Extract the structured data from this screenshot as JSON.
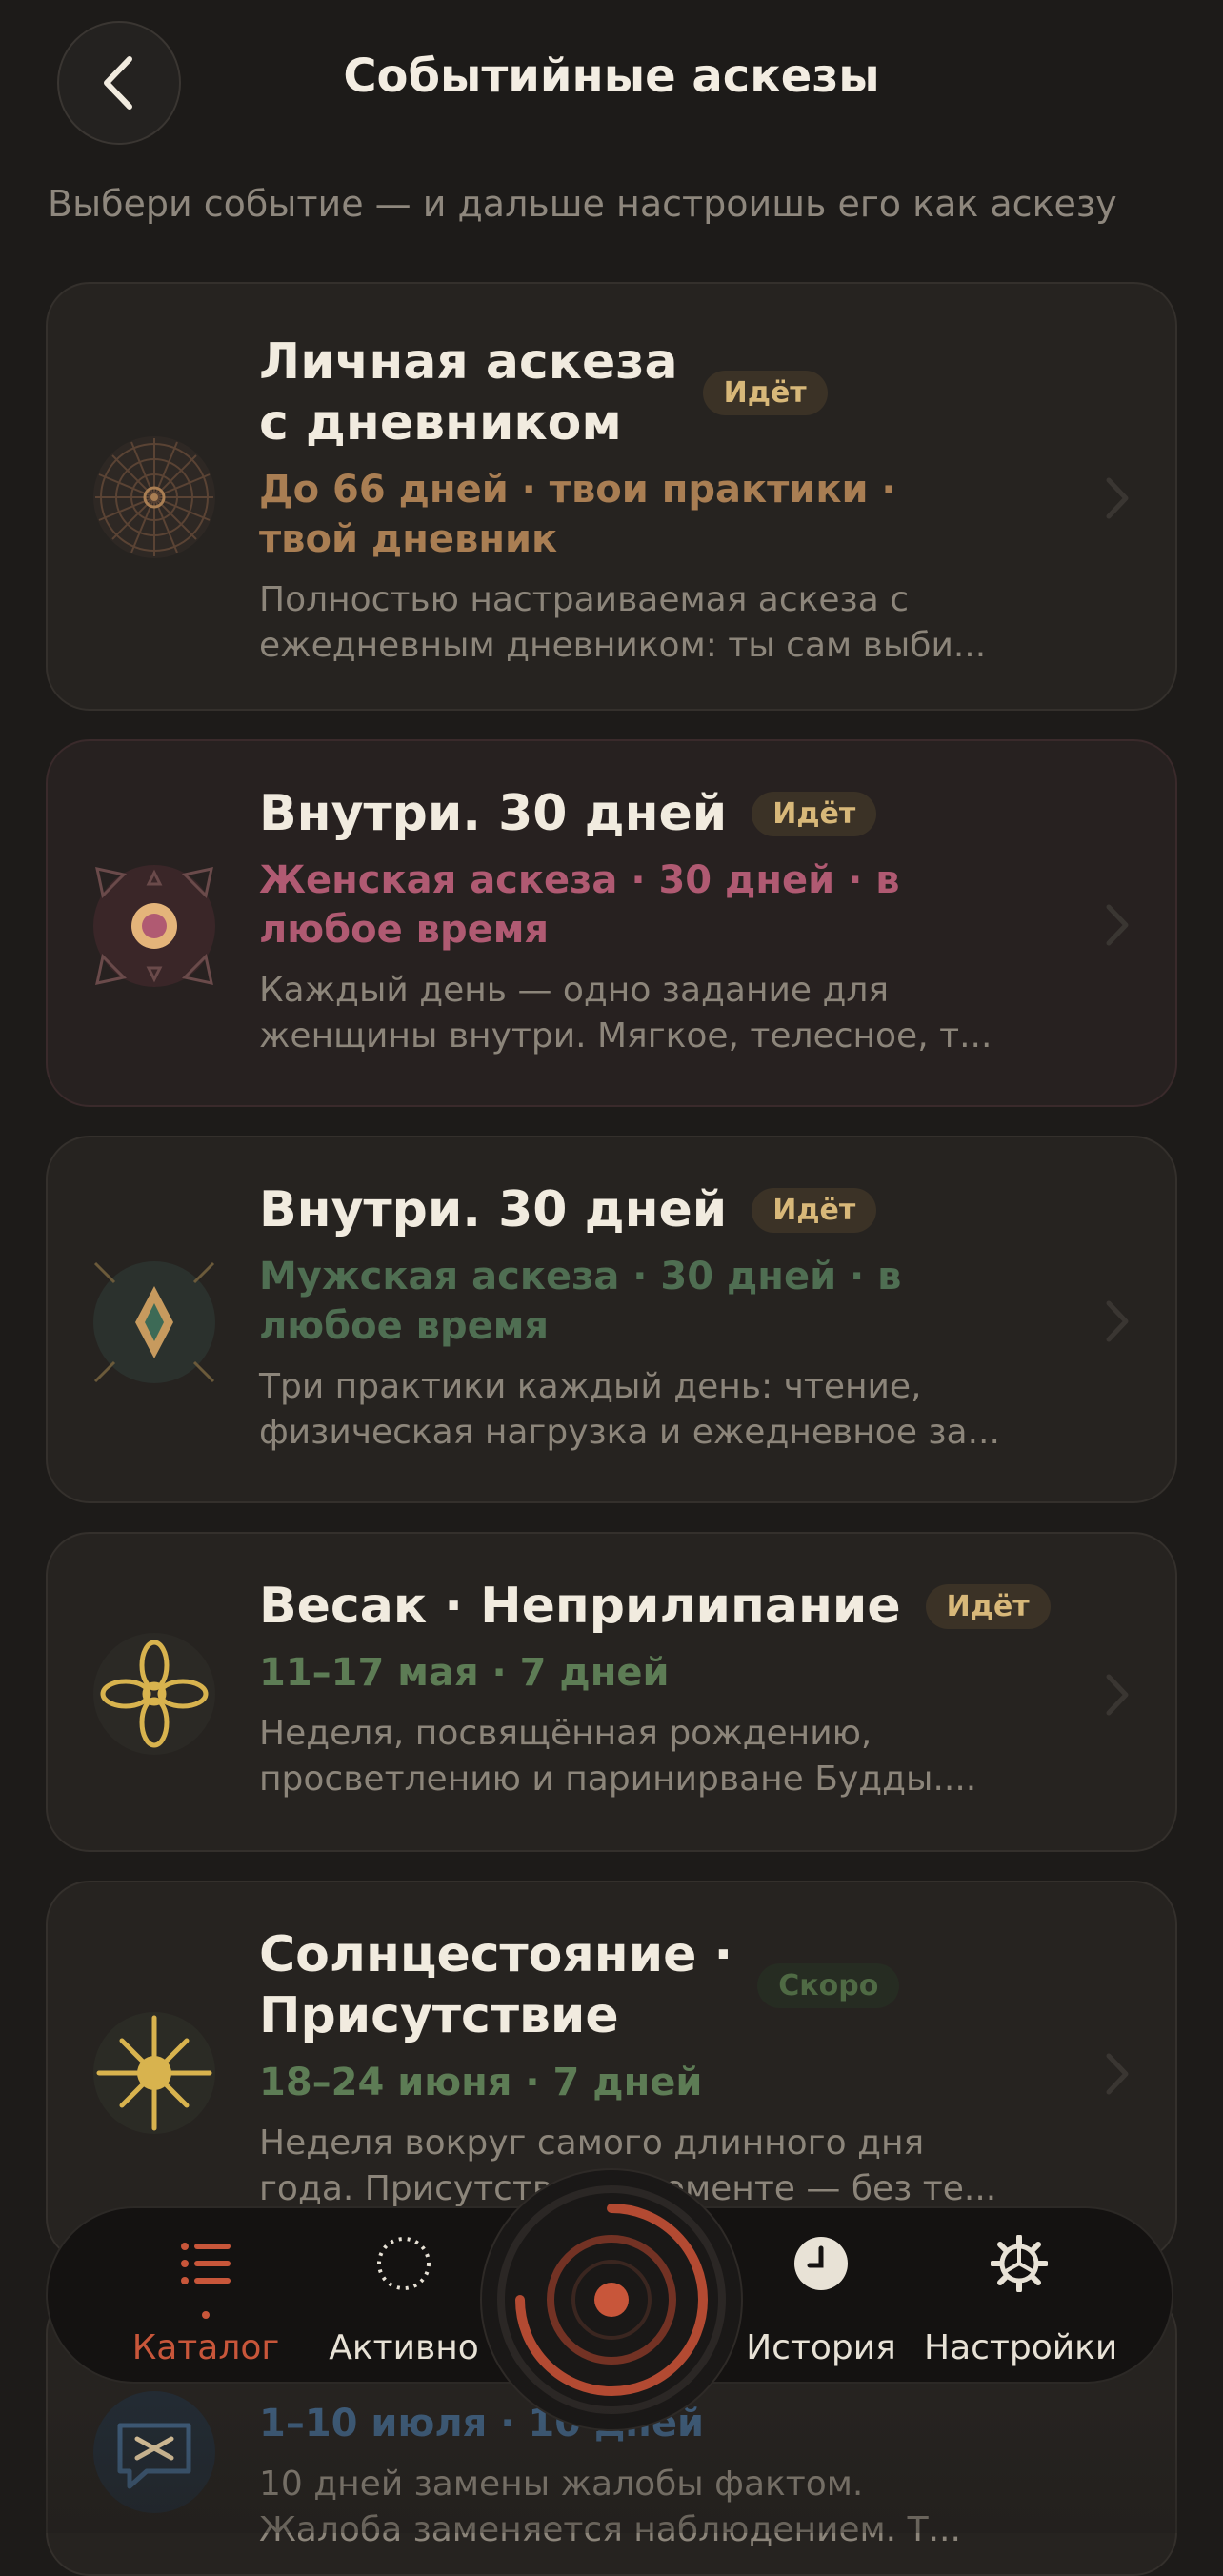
{
  "header": {
    "title": "Событийные аскезы",
    "subtitle": "Выбери событие — и дальше настроишь его как аскезу"
  },
  "cards": [
    {
      "title": "Личная аскеза с дневником",
      "title_l1": "Личная аскеза",
      "title_l2": "с дневником",
      "badge": "Идёт",
      "meta_l1": "До 66 дней · твои практики ·",
      "meta_l2": "твой дневник",
      "desc_l1": "Полностью настраиваемая аскеза с",
      "desc_l2": "ежедневным дневником: ты сам выби...",
      "accent": "#a97e53",
      "icon": "mandala-icon"
    },
    {
      "title": "Внутри. 30 дней",
      "badge": "Идёт",
      "meta_l1": "Женская аскеза · 30 дней · в",
      "meta_l2": "любое время",
      "desc_l1": "Каждый день — одно задание для",
      "desc_l2": "женщины внутри. Мягкое, телесное, т...",
      "accent": "#b05a72",
      "icon": "circle-petals-icon"
    },
    {
      "title": "Внутри. 30 дней",
      "badge": "Идёт",
      "meta_l1": "Мужская аскеза · 30 дней · в",
      "meta_l2": "любое время",
      "desc_l1": "Три практики каждый день: чтение,",
      "desc_l2": "физическая нагрузка и ежедневное за...",
      "accent": "#4f6e52",
      "icon": "diamond-icon"
    },
    {
      "title": "Весак · Неприлипание",
      "badge": "Идёт",
      "meta_l1": "11–17 мая · 7 дней",
      "desc_l1": "Неделя, посвящённая рождению,",
      "desc_l2": "просветлению и паринирване Будды....",
      "accent": "#5d7c55",
      "icon": "lotus-icon"
    },
    {
      "title": "Солнцестояние · Присутствие",
      "title_l1": "Солнцестояние ·",
      "title_l2": "Присутствие",
      "badge": "Скоро",
      "meta_l1": "18–24 июня · 7 дней",
      "desc_l1": "Неделя вокруг самого длинного дня",
      "desc_l2": "года. Присутствие в моменте — без те...",
      "accent": "#5d7c55",
      "icon": "sun-icon"
    },
    {
      "title": "",
      "meta_l1": "1–10 июля · 10 дней",
      "desc_l1": "10 дней замены жалобы фактом.",
      "desc_l2": "Жалоба заменяется наблюдением. Т...",
      "accent": "#3e5b78",
      "icon": "chat-icon"
    }
  ],
  "tabbar": {
    "tabs": [
      {
        "label": "Каталог",
        "icon": "list-icon",
        "active": true
      },
      {
        "label": "Активно",
        "icon": "dotted-circle-icon",
        "active": false
      },
      {
        "label": "История",
        "icon": "clock-icon",
        "active": false
      },
      {
        "label": "Настройки",
        "icon": "gear-icon",
        "active": false
      }
    ],
    "center": "record-icon"
  },
  "colors": {
    "background": "#1d1b19",
    "active": "#c8563a",
    "badge_running": "#d8b879",
    "badge_soon": "#4f6a44"
  }
}
